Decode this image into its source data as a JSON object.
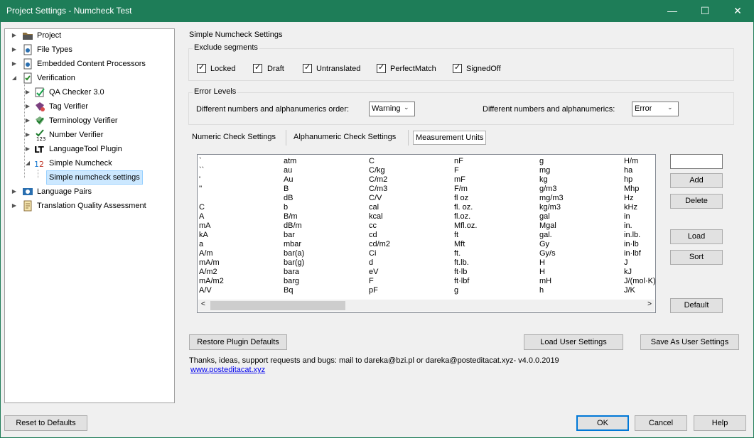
{
  "window": {
    "title": "Project Settings - Numcheck Test",
    "minimize": "—",
    "maximize": "☐",
    "close": "✕"
  },
  "tree": {
    "items": [
      {
        "label": "Project",
        "icon": "folder-icon"
      },
      {
        "label": "File Types",
        "icon": "file-types-icon"
      },
      {
        "label": "Embedded Content Processors",
        "icon": "processor-icon"
      },
      {
        "label": "Verification",
        "icon": "verification-icon"
      },
      {
        "label": "QA Checker 3.0",
        "icon": "qa-checker-icon"
      },
      {
        "label": "Tag Verifier",
        "icon": "tag-verifier-icon"
      },
      {
        "label": "Terminology Verifier",
        "icon": "terminology-verifier-icon"
      },
      {
        "label": "Number Verifier",
        "icon": "number-verifier-icon"
      },
      {
        "label": "LanguageTool Plugin",
        "icon": "languagetool-icon"
      },
      {
        "label": "Simple Numcheck",
        "icon": "numcheck-icon"
      },
      {
        "label": "Simple numcheck settings",
        "icon": ""
      },
      {
        "label": "Language Pairs",
        "icon": "language-pairs-icon"
      },
      {
        "label": "Translation Quality Assessment",
        "icon": "tqa-icon"
      }
    ]
  },
  "settings": {
    "heading": "Simple Numcheck Settings",
    "exclude": {
      "label": "Exclude segments",
      "options": [
        {
          "label": "Locked",
          "checked": true
        },
        {
          "label": "Draft",
          "checked": true
        },
        {
          "label": "Untranslated",
          "checked": true
        },
        {
          "label": "PerfectMatch",
          "checked": true
        },
        {
          "label": "SignedOff",
          "checked": true
        }
      ]
    },
    "error_levels": {
      "label": "Error Levels",
      "order_label": "Different numbers and alphanumerics order:",
      "order_value": "Warning",
      "diff_label": "Different numbers and alphanumerics:",
      "diff_value": "Error"
    },
    "tabs": [
      "Numeric Check Settings",
      "Alphanumeric Check Settings",
      "Measurement Units"
    ],
    "units_columns": [
      [
        "`",
        "``",
        "'",
        "''",
        "",
        "C",
        "A",
        "mA",
        "kA",
        "a",
        "A/m",
        "mA/m",
        "A/m2",
        "mA/m2",
        "A/V"
      ],
      [
        "atm",
        "au",
        "Au",
        "B",
        "dB",
        "b",
        "B/m",
        "dB/m",
        "bar",
        "mbar",
        "bar(a)",
        "bar(g)",
        "bara",
        "barg",
        "Bq"
      ],
      [
        "C",
        "C/kg",
        "C/m2",
        "C/m3",
        "C/V",
        "cal",
        "kcal",
        "cc",
        "cd",
        "cd/m2",
        "Ci",
        "d",
        "eV",
        "F",
        "pF"
      ],
      [
        "nF",
        "F",
        "mF",
        "F/m",
        "fl oz",
        "fl. oz.",
        "fl.oz.",
        "Mfl.oz.",
        "ft",
        "Mft",
        "ft.",
        "ft.lb.",
        "ft·lb",
        "ft·lbf",
        "g"
      ],
      [
        "g",
        "mg",
        "kg",
        "g/m3",
        "mg/m3",
        "kg/m3",
        "gal",
        "Mgal",
        "gal.",
        "Gy",
        "Gy/s",
        "H",
        "H",
        "mH",
        "h"
      ],
      [
        "H/m",
        "ha",
        "hp",
        "Mhp",
        "Hz",
        "kHz",
        "in",
        "in.",
        "in.lb.",
        "in·lb",
        "in·lbf",
        "J",
        "kJ",
        "J/(mol·K)",
        "J/K"
      ]
    ],
    "unit_input": "",
    "buttons": {
      "add": "Add",
      "delete": "Delete",
      "load": "Load",
      "sort": "Sort",
      "default": "Default"
    },
    "restore": "Restore Plugin Defaults",
    "load_user": "Load User Settings",
    "save_user": "Save As User Settings",
    "info": "Thanks, ideas, support requests and bugs: mail to dareka@bzi.pl or dareka@posteditacat.xyz- v4.0.0.2019",
    "link": "www.posteditacat.xyz"
  },
  "footer": {
    "reset": "Reset to Defaults",
    "ok": "OK",
    "cancel": "Cancel",
    "help": "Help"
  }
}
